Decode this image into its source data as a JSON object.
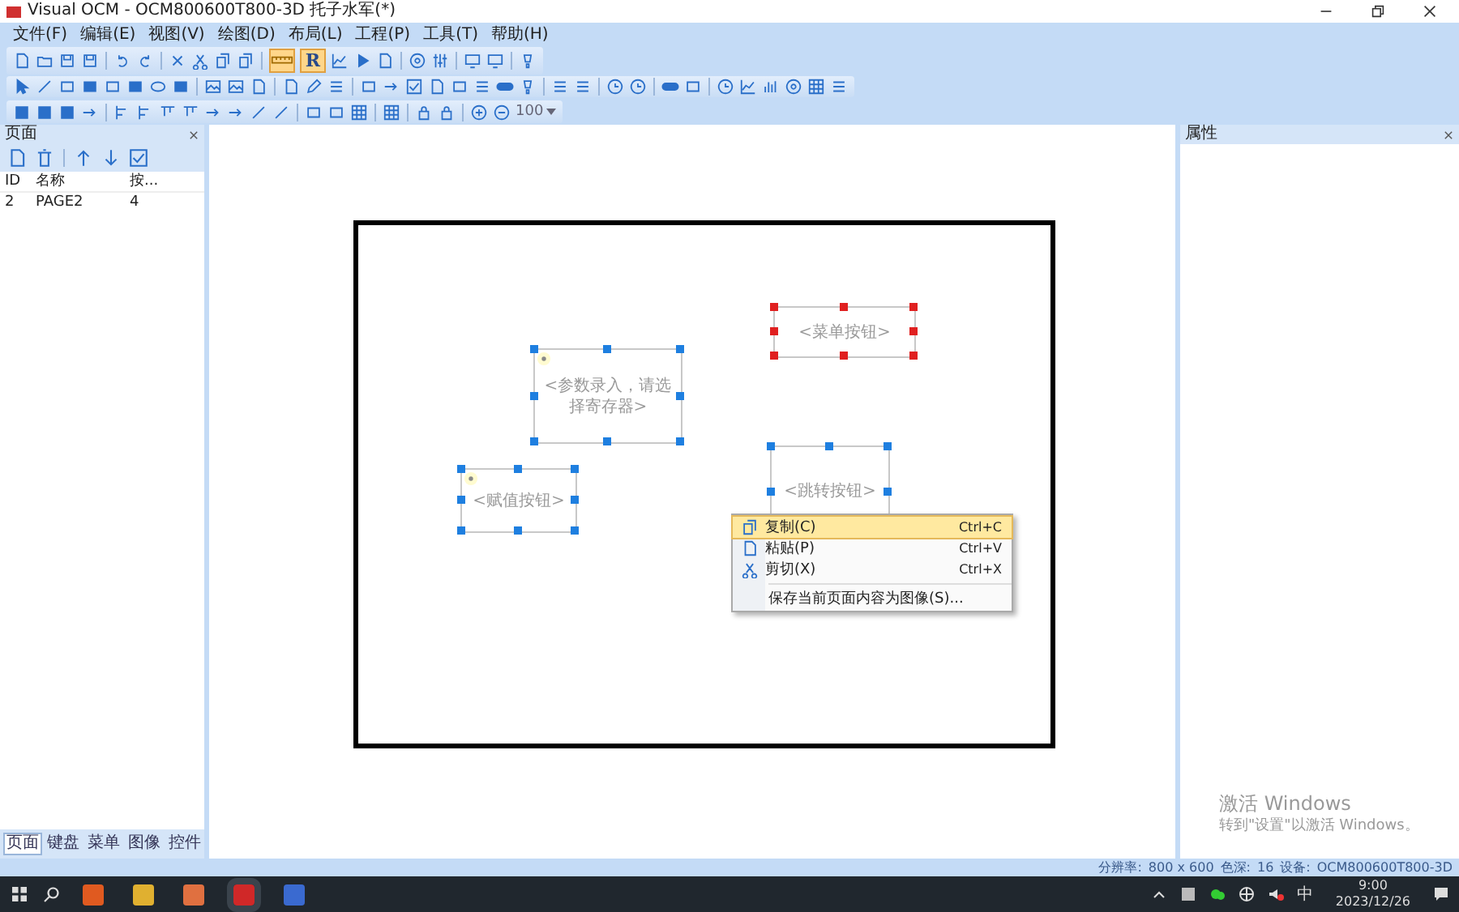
{
  "window": {
    "title": "Visual OCM - OCM800600T800-3D 托子水军(*)"
  },
  "menu_bar": [
    "文件(F)",
    "编辑(E)",
    "视图(V)",
    "绘图(D)",
    "布局(L)",
    "工程(P)",
    "工具(T)",
    "帮助(H)"
  ],
  "toolbar_toggles": [
    {
      "on": true
    },
    {
      "label": "R",
      "on": true
    }
  ],
  "zoom": "100",
  "pages_panel": {
    "title": "页面",
    "columns": [
      "ID",
      "名称",
      "按..."
    ],
    "rows": [
      {
        "cells": [
          "2",
          "PAGE2",
          "4"
        ],
        "selected": false
      }
    ],
    "tabs": [
      {
        "label": "页面",
        "selected": true
      },
      {
        "label": "键盘",
        "selected": false
      },
      {
        "label": "菜单",
        "selected": false
      },
      {
        "label": "图像",
        "selected": false
      },
      {
        "label": "控件",
        "selected": false
      }
    ]
  },
  "properties_panel": {
    "title": "属性"
  },
  "widgets": [
    {
      "label": "<参数录入，请选择寄存器>",
      "help_mark": true,
      "selected": true,
      "color": "#1e7fe0"
    },
    {
      "label": "<菜单按钮>",
      "help_mark": false,
      "selected": true,
      "color": "#e02020"
    },
    {
      "label": "<赋值按钮>",
      "help_mark": true,
      "selected": true,
      "color": "#1e7fe0"
    },
    {
      "label": "<跳转按钮>",
      "help_mark": false,
      "selected": true,
      "color": "#1e7fe0"
    }
  ],
  "context_menu": [
    {
      "kind": "copy",
      "label": "复制(C)",
      "shortcut": "Ctrl+C",
      "selected": true
    },
    {
      "kind": "paste",
      "label": "粘贴(P)",
      "shortcut": "Ctrl+V",
      "selected": false
    },
    {
      "kind": "cut",
      "label": "剪切(X)",
      "shortcut": "Ctrl+X",
      "selected": false
    },
    {
      "kind": "plain",
      "label": "保存当前页面内容为图像(S)...",
      "selected": false
    }
  ],
  "os_notice": {
    "title": "激活 Windows",
    "subtitle": "转到\"设置\"以激活 Windows。"
  },
  "status_bar": {
    "resolution_label": "分辨率:",
    "resolution": "800 x 600",
    "depth_label": "色深:",
    "depth": "16",
    "device_label": "设备:",
    "device": "OCM800600T800-3D"
  },
  "taskbar": {
    "ime": "中",
    "time": "9:00",
    "date": "2023/12/26"
  }
}
